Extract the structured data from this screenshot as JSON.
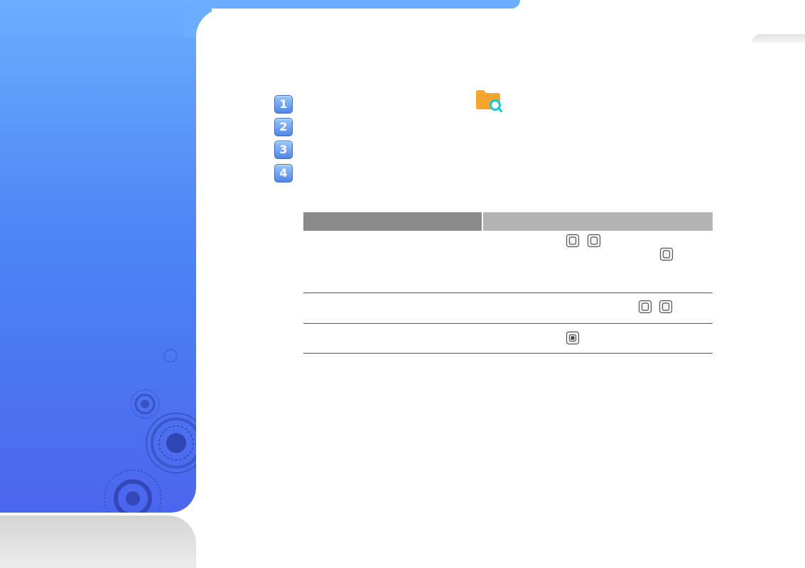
{
  "steps": [
    {
      "label": "1"
    },
    {
      "label": "2"
    },
    {
      "label": "3"
    },
    {
      "label": "4"
    }
  ],
  "icons": {
    "folder_search": "folder-search-icon",
    "key_button": "square-key-icon",
    "center_button": "center-key-icon"
  },
  "colors": {
    "sidebar_top": "#6aaeff",
    "sidebar_bottom": "#4b66ee",
    "folder": "#f7a531",
    "magnifier": "#19c6d6",
    "table_header_dark": "#8a8a8a",
    "table_header_light": "#b3b3b3"
  },
  "table": {
    "columns": [
      "",
      ""
    ],
    "rows": 3
  }
}
